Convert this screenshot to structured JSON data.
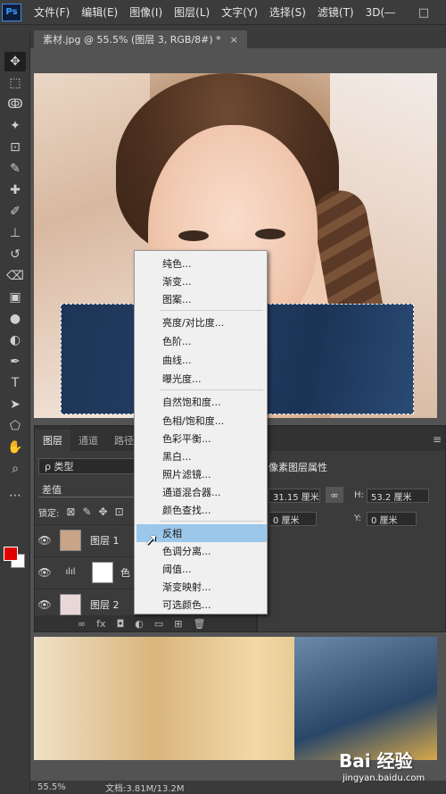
{
  "app": {
    "logo": "Ps"
  },
  "menubar": {
    "items": [
      "文件(F)",
      "编辑(E)",
      "图像(I)",
      "图层(L)",
      "文字(Y)",
      "选择(S)",
      "滤镜(T)",
      "3D("
    ],
    "window_buttons": [
      "—",
      "□"
    ]
  },
  "document_tab": {
    "title": "素材.jpg @ 55.5% (图层 3, RGB/8#) *",
    "close": "×"
  },
  "toolbar": {
    "tools": [
      "move-icon",
      "marquee-icon",
      "lasso-icon",
      "magic-wand-icon",
      "crop-icon",
      "eyedropper-icon",
      "healing-icon",
      "brush-icon",
      "stamp-icon",
      "history-brush-icon",
      "eraser-icon",
      "gradient-icon",
      "blur-icon",
      "dodge-icon",
      "pen-icon",
      "type-icon",
      "path-select-icon",
      "shape-icon",
      "hand-icon",
      "zoom-icon",
      "more-icon"
    ],
    "glyphs": [
      "✥",
      "⬚",
      "ↂ",
      "✦",
      "⊡",
      "✎",
      "✚",
      "✐",
      "⊥",
      "↺",
      "⌫",
      "▣",
      "●",
      "◐",
      "✒",
      "T",
      "➤",
      "⬠",
      "✋",
      "⌕",
      "⋯"
    ],
    "fg_color": "#e00000",
    "bg_color": "#ffffff"
  },
  "layers_panel": {
    "tabs": [
      "图层",
      "通道",
      "路径"
    ],
    "filter_label": "ρ 类型",
    "blend_mode": "差值",
    "lock_label": "锁定:",
    "lock_icons": [
      "⊠",
      "✎",
      "✥",
      "⊡"
    ],
    "layers": [
      {
        "name": "图层 1",
        "visible": "👁",
        "thumb_color": "#c9a487"
      },
      {
        "name": "色",
        "visible": "👁",
        "thumb_color": "#ffffff"
      },
      {
        "name": "图层 2",
        "visible": "👁",
        "thumb_color": "#e9d7d7"
      }
    ],
    "footer_icons": [
      "∞",
      "fx",
      "◘",
      "◐",
      "▭",
      "⊞",
      "🗑"
    ]
  },
  "properties_panel": {
    "title": "像素图层属性",
    "w_value": "31.15 厘米",
    "h_label": "H:",
    "h_value": "53.2 厘米",
    "x_value": "0 厘米",
    "y_label": "Y:",
    "y_value": "0 厘米",
    "link_glyph": "∞",
    "menu_glyph": "≡"
  },
  "context_menu": {
    "items": [
      {
        "label": "纯色...",
        "highlighted": false
      },
      {
        "label": "渐变...",
        "highlighted": false
      },
      {
        "label": "图案...",
        "highlighted": false
      },
      {
        "label": "亮度/对比度...",
        "highlighted": false
      },
      {
        "label": "色阶...",
        "highlighted": false
      },
      {
        "label": "曲线...",
        "highlighted": false
      },
      {
        "label": "曝光度...",
        "highlighted": false
      },
      {
        "label": "自然饱和度...",
        "highlighted": false
      },
      {
        "label": "色相/饱和度...",
        "highlighted": false
      },
      {
        "label": "色彩平衡...",
        "highlighted": false
      },
      {
        "label": "黑白...",
        "highlighted": false
      },
      {
        "label": "照片滤镜...",
        "highlighted": false
      },
      {
        "label": "通道混合器...",
        "highlighted": false
      },
      {
        "label": "颜色查找...",
        "highlighted": false
      },
      {
        "label": "反相",
        "highlighted": true
      },
      {
        "label": "色调分离...",
        "highlighted": false
      },
      {
        "label": "阈值...",
        "highlighted": false
      },
      {
        "label": "渐变映射...",
        "highlighted": false
      },
      {
        "label": "可选颜色...",
        "highlighted": false
      }
    ],
    "highlight_color": "#9bc7ea"
  },
  "statusbar": {
    "zoom": "55.5%",
    "doc_info": "文档:3.81M/13.2M"
  },
  "watermark": {
    "brand": "Bai 经验",
    "sub": "jingyan.baidu.com"
  }
}
